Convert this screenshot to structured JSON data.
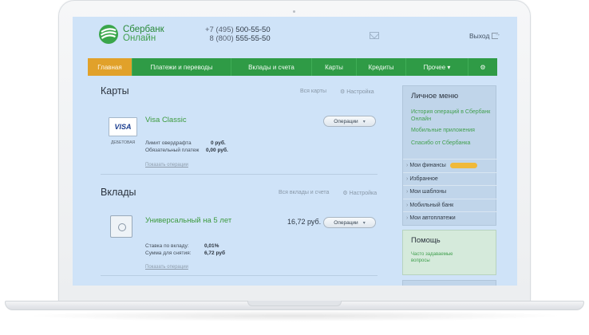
{
  "brand": {
    "line1": "Сбербанк",
    "line2": "Онлайн",
    "color": "#2a8a3a"
  },
  "header": {
    "phone1_prefix": "+7 (495) ",
    "phone1_main": "500-55-50",
    "phone2_prefix": "8 (800) ",
    "phone2_main": "555-55-50",
    "logout_label": "Выход",
    "mail_icon": "mail-icon"
  },
  "nav": {
    "accent": "#2f9b46",
    "active_color": "#e1a12a",
    "items": [
      {
        "label": "Главная"
      },
      {
        "label": "Платежи и переводы"
      },
      {
        "label": "Вклады и счета"
      },
      {
        "label": "Карты"
      },
      {
        "label": "Кредиты"
      },
      {
        "label": "Прочее ▾"
      },
      {
        "label": "⚙"
      }
    ]
  },
  "cards_section": {
    "title": "Карты",
    "all_link": "Вся карты",
    "settings_link": "Настройка",
    "card_logo": "VISA",
    "card_type": "ДЕБЕТОВАЯ",
    "name": "Visa Classic",
    "op_button": "Операции",
    "details": [
      {
        "label": "Лимит овердрафта",
        "value": "0 руб."
      },
      {
        "label": "Обязательный платеж",
        "value": "0,00 руб."
      }
    ],
    "show_ops": "Показать операции"
  },
  "deposits_section": {
    "title": "Вклады",
    "all_link": "Вся вклады и счета",
    "settings_link": "Настройка",
    "name": "Универсальный на 5 лет",
    "amount": "16,72 руб.",
    "op_button": "Операции",
    "details": [
      {
        "label": "Ставка по вкладу:",
        "value": "0,01%"
      },
      {
        "label": "Сумма для снятия:",
        "value": "6,72 руб"
      }
    ],
    "show_ops": "Показать операции"
  },
  "side_menu": {
    "title": "Личное меню",
    "links": [
      "История операций в Сбербанк Онлайн",
      "Мобильные приложения",
      "Спасибо от Сбербанка"
    ],
    "items": [
      "Мои финансы",
      "Избранное",
      "Мои шаблоны",
      "Мобильный банк",
      "Мои автоплатежи"
    ]
  },
  "help_box": {
    "title": "Помощь",
    "link": "Часто задаваемые вопросы"
  }
}
